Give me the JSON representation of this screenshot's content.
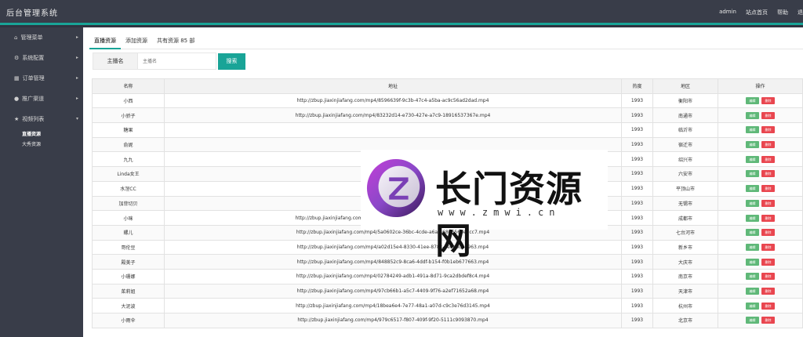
{
  "header": {
    "brand": "后台管理系统",
    "nav": [
      "admin",
      "站点首页",
      "帮助",
      "退"
    ]
  },
  "sidebar": {
    "items": [
      {
        "icon": "home-icon",
        "label": "管理菜单"
      },
      {
        "icon": "gears-icon",
        "label": "系统配置"
      },
      {
        "icon": "bar-chart-icon",
        "label": "订单管理"
      },
      {
        "icon": "user-icon",
        "label": "推广渠道"
      },
      {
        "icon": "star-icon",
        "label": "视频列表"
      }
    ],
    "subitems": [
      "直播资源",
      "大秀资源"
    ]
  },
  "tabs": [
    "直播资源",
    "添加资源",
    "共有资源 85 部"
  ],
  "search": {
    "label": "主播名",
    "placeholder": "主播名",
    "button": "搜索"
  },
  "table": {
    "columns": [
      "名称",
      "地址",
      "热度",
      "地区",
      "操作"
    ],
    "edit_label": "编辑",
    "delete_label": "删除",
    "rows": [
      {
        "name": "小西",
        "url": "http://zbup.jiaxinjiafang.com/mp4/8596639f-9c3b-47c4-a5ba-ac9c56ad2dad.mp4",
        "heat": "1993",
        "region": "衡阳市"
      },
      {
        "name": "小骄子",
        "url": "http://zbup.jiaxinjiafang.com/mp4/83232d14-e730-427e-a7c9-18916537367e.mp4",
        "heat": "1993",
        "region": "南通市"
      },
      {
        "name": "糖果",
        "url": "",
        "heat": "1993",
        "region": "临沂市"
      },
      {
        "name": "俞妮",
        "url": "",
        "heat": "1993",
        "region": "宿迁市"
      },
      {
        "name": "九九",
        "url": "",
        "heat": "1993",
        "region": "绍兴市"
      },
      {
        "name": "Linda女王",
        "url": "",
        "heat": "1993",
        "region": "六安市"
      },
      {
        "name": "水涅CC",
        "url": "",
        "heat": "1993",
        "region": "平顶山市"
      },
      {
        "name": "加菲切贝",
        "url": "",
        "heat": "1993",
        "region": "无锡市"
      },
      {
        "name": "小咪",
        "url": "http://zbup.jiaxinjiafang.com/mp4/41216a99-3786-496a-8d45-d5a285e9d52a.mp4",
        "heat": "1993",
        "region": "成都市"
      },
      {
        "name": "螺儿",
        "url": "http://zbup.jiaxinjiafang.com/mp4/5a0602ce-36bc-4cde-a6a3-6806566e7cc7.mp4",
        "heat": "1993",
        "region": "七台河市"
      },
      {
        "name": "哥伦豆",
        "url": "http://zbup.jiaxinjiafang.com/mp4/a02d15e4-8330-41ee-878c-de0e6da7963.mp4",
        "heat": "1993",
        "region": "新乡市"
      },
      {
        "name": "殿美子",
        "url": "http://zbup.jiaxinjiafang.com/mp4/848852c9-8ca6-4ddf-b154-f0b1eb677663.mp4",
        "heat": "1993",
        "region": "大庆市"
      },
      {
        "name": "小珊娜",
        "url": "http://zbup.jiaxinjiafang.com/mp4/02784249-adb1-491a-8d71-9ca2dbdef8c4.mp4",
        "heat": "1993",
        "region": "南京市"
      },
      {
        "name": "茱莉姐",
        "url": "http://zbup.jiaxinjiafang.com/mp4/97cb66b1-a5c7-4409-9f76-a2ef71652a68.mp4",
        "heat": "1993",
        "region": "天津市"
      },
      {
        "name": "大泥波",
        "url": "http://zbup.jiaxinjiafang.com/mp4/18bea6e4-7e77-48a1-a07d-c9c3e76d3145.mp4",
        "heat": "1993",
        "region": "杭州市"
      },
      {
        "name": "小雨伞",
        "url": "http://zbup.jiaxinjiafang.com/mp4/979c6517-f807-409f-9f20-5111c9093870.mp4",
        "heat": "1993",
        "region": "北京市"
      }
    ]
  },
  "watermark": {
    "title": "长门资源网",
    "url": "www.zmwi.cn"
  },
  "colors": {
    "accent": "#19a497",
    "sidebar_bg": "#393d49",
    "edit": "#5fb878",
    "delete": "#e9464f"
  }
}
